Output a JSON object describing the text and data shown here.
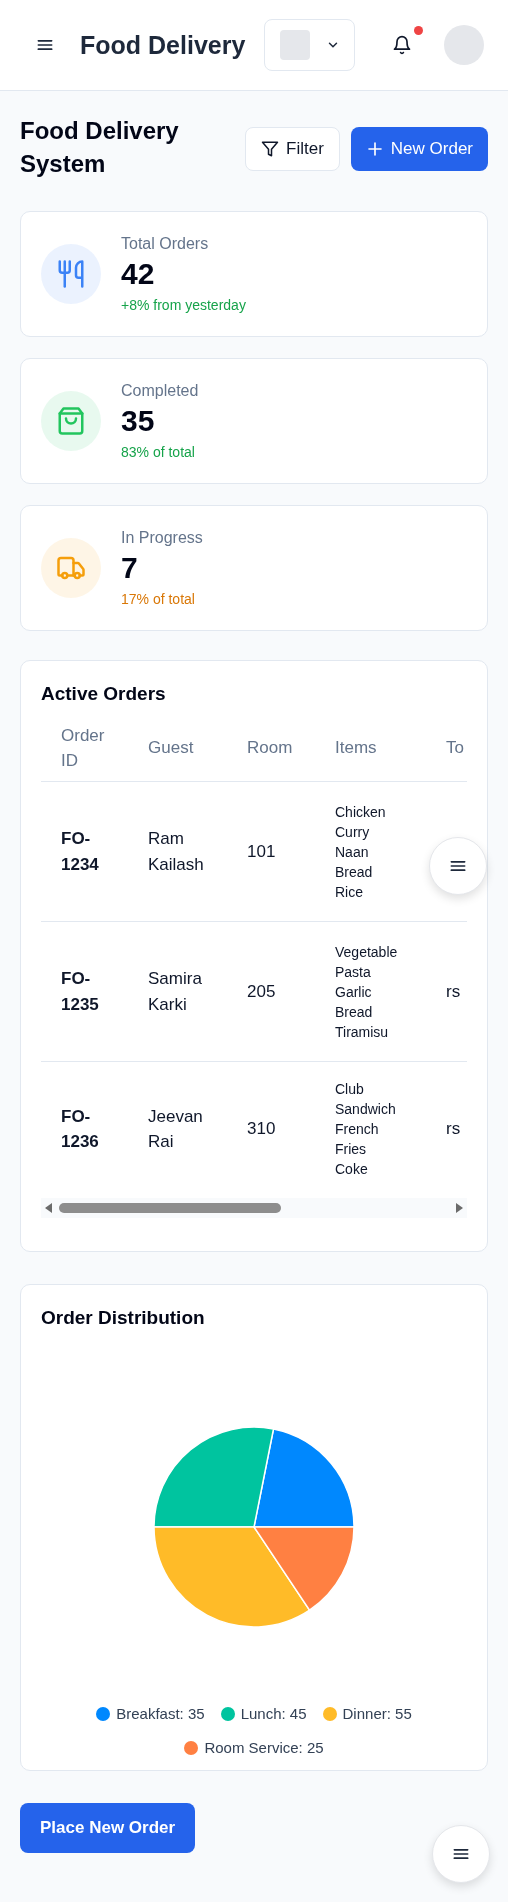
{
  "header": {
    "title": "Food Delivery",
    "notification_badge": true
  },
  "page": {
    "title": "Food Delivery System",
    "buttons": [
      {
        "kind": "filter",
        "label": "Filter"
      },
      {
        "kind": "new",
        "label": "New Order"
      }
    ]
  },
  "stats": [
    {
      "kind": "orders",
      "label": "Total Orders",
      "value": "42",
      "note": "+8% from yesterday",
      "color": "#3b82f6"
    },
    {
      "kind": "completed",
      "label": "Completed",
      "value": "35",
      "note": "83% of total",
      "color": "#22c55e"
    },
    {
      "kind": "progress",
      "label": "In Progress",
      "value": "7",
      "note": "17% of total",
      "color": "#f59e0b"
    }
  ],
  "orders": {
    "title": "Active Orders",
    "columns": [
      "Order ID",
      "Guest",
      "Room",
      "Items",
      "To"
    ],
    "rows": [
      [
        "FO-1234",
        "Ram Kailash",
        "101",
        "Chicken Curry Naan Bread Rice"
      ],
      [
        "FO-1235",
        "Samira Karki",
        "205",
        "Vegetable Pasta Garlic Bread Tiramisu",
        "rs"
      ],
      [
        "FO-1236",
        "Jeevan Rai",
        "310",
        "Club Sandwich French Fries Coke",
        "rs"
      ]
    ]
  },
  "distribution": {
    "chart_data": {
      "type": "pie",
      "title": "Order Distribution",
      "values": [
        21.875,
        28.125,
        34.375,
        15.625
      ]
    },
    "legend": [
      {
        "label": "Breakfast: 35",
        "color": "#0088fe"
      },
      {
        "label": "Lunch: 45",
        "color": "#00c49f"
      },
      {
        "label": "Dinner: 55",
        "color": "#ffbb28"
      },
      {
        "label": "Room Service: 25",
        "color": "#ff8042"
      }
    ]
  },
  "place_order_button": "Place New Order"
}
